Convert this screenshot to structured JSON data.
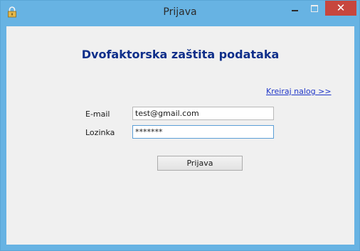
{
  "window": {
    "title": "Prijava",
    "close_glyph": "✕"
  },
  "form": {
    "heading": "Dvofaktorska zaštita podataka",
    "create_account_link": "Kreiraj nalog >>",
    "email_label": "E-mail",
    "email_value": "test@gmail.com",
    "password_label": "Lozinka",
    "password_value": "*******",
    "submit_label": "Prijava"
  },
  "icons": {
    "app": "lock-icon",
    "minimize": "minimize-icon",
    "maximize": "maximize-icon",
    "close": "close-icon"
  },
  "colors": {
    "titlebar": "#67b3e3",
    "close_button": "#c7463e",
    "heading": "#0f2f8a",
    "link": "#1f36c8",
    "client_bg": "#f0f0f0"
  }
}
